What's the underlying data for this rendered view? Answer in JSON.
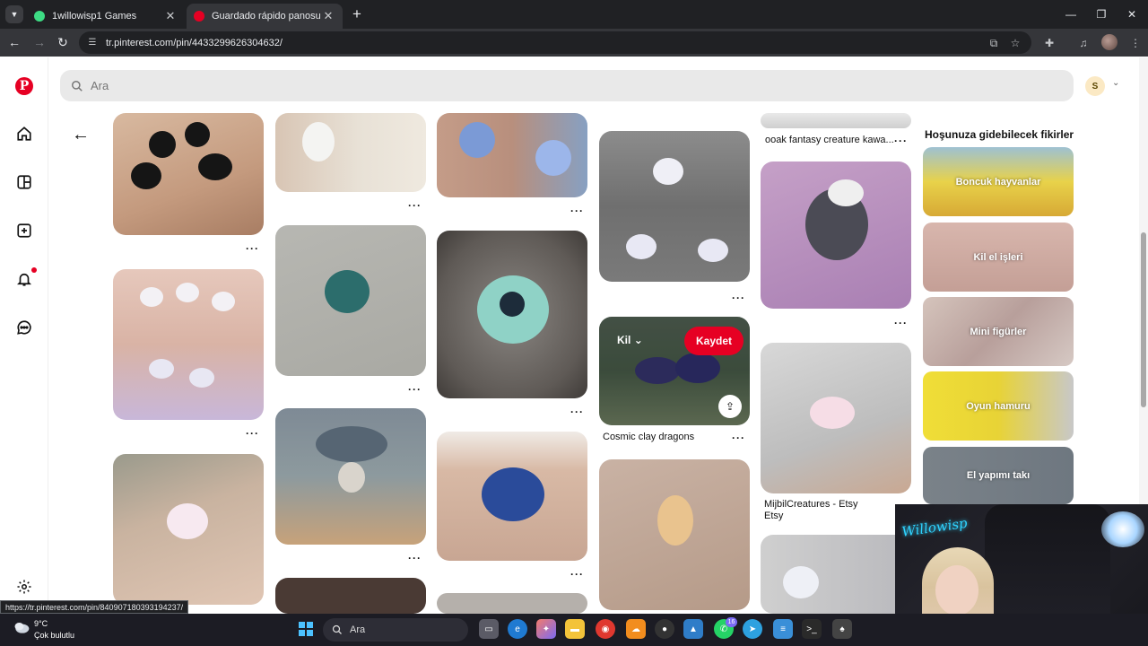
{
  "browser": {
    "tabs": [
      {
        "title": "1willowisp1 Games",
        "active": false
      },
      {
        "title": "Guardado rápido panosundaki",
        "active": true
      }
    ],
    "url": "tr.pinterest.com/pin/4433299626304632/",
    "status_url": "https://tr.pinterest.com/pin/840907180393194237/"
  },
  "pinterest": {
    "search_placeholder": "Ara",
    "avatar_initial": "S",
    "hover_pin": {
      "board": "Kil",
      "save": "Kaydet"
    },
    "pins": {
      "cosmic_title": "Cosmic clay dragons",
      "ooak_title": "ooak fantasy creature kawa...",
      "mijbil_title": "MijbilCreatures - Etsy",
      "mijbil_sub": "Etsy"
    },
    "ideas": {
      "heading": "Hoşunuza gidebilecek fikirler",
      "items": [
        {
          "label": "Boncuk hayvanlar"
        },
        {
          "label": "Kil el işleri"
        },
        {
          "label": "Mini figürler"
        },
        {
          "label": "Oyun hamuru"
        },
        {
          "label": "El yapımı takı"
        }
      ]
    }
  },
  "taskbar": {
    "temperature": "9°C",
    "weather": "Çok bulutlu",
    "search": "Ara",
    "whatsapp_badge": "16"
  },
  "colors": {
    "brand": "#e60023",
    "chrome_dark": "#202124",
    "chrome_toolbar": "#35363a"
  }
}
